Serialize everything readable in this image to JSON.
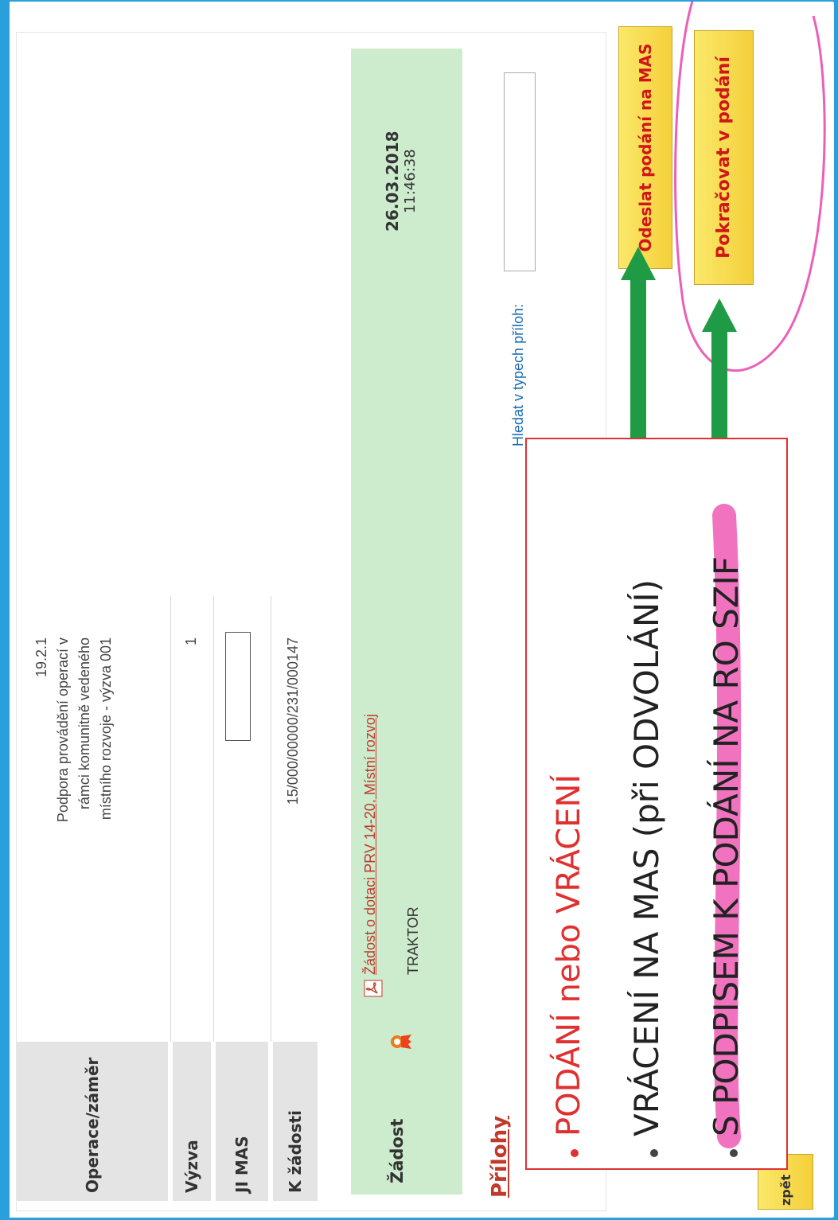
{
  "form": {
    "operace_label": "Operace/záměr",
    "operace_code": "19.2.1",
    "operace_line1": "Podpora provádění operací v",
    "operace_line2": "rámci komunitně vedeného",
    "operace_line3": "místního rozvoje - výzva 001",
    "vyzva_label": "Výzva",
    "vyzva_value": "1",
    "jimas_label": "JI MAS",
    "jimas_value": "",
    "kzadosti_label": "K žádosti",
    "kzadosti_value": "15/000/00000/231/000147"
  },
  "zadost": {
    "label": "Žádost",
    "link": "Žádost o dotaci PRV 14-20, Místní rozvoj",
    "subtitle": "TRAKTOR",
    "date": "26.03.2018",
    "time": "11:46:38"
  },
  "prilohy": {
    "heading": "Přílohy",
    "search_label": "Hledat v typech příloh:",
    "search_value": "",
    "hidden_button_fragment": "zpět"
  },
  "actions": {
    "send_to_mas": "Odeslat podání na MAS",
    "continue": "Pokračovat v podání"
  },
  "annotation": {
    "title_part1": "PODÁNÍ",
    "title_part2": " nebo ",
    "title_part3": "VRÁCENÍ",
    "bullet1": "VRÁCENÍ NA MAS (při ODVOLÁNÍ)",
    "bullet2": "S PODPISEM K PODÁNÍ NA RO SZIF"
  },
  "colors": {
    "frame": "#29a0dc",
    "green_row": "#cdeccd",
    "button": "#f4d03a",
    "button_text": "#d01616",
    "annotation_red": "#e03030",
    "arrow_green": "#1f9a45",
    "highlight_pink": "#f06bbd"
  },
  "icons": [
    "pdf-icon",
    "ribbon-icon",
    "arrow-up-icon"
  ]
}
